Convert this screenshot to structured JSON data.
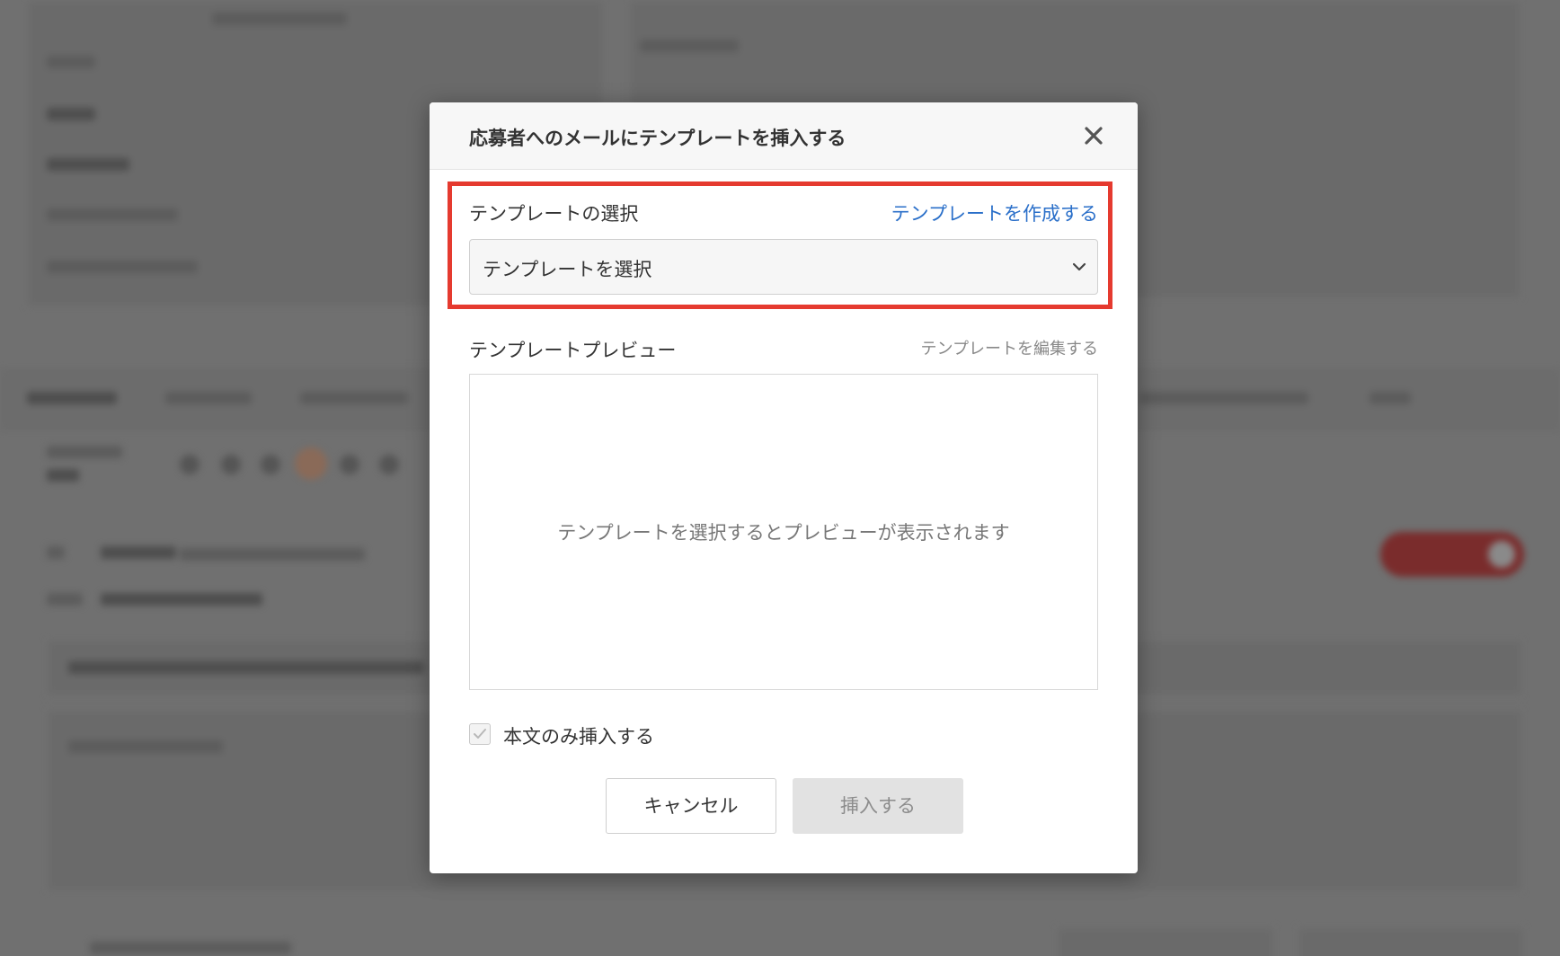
{
  "modal": {
    "title": "応募者へのメールにテンプレートを挿入する",
    "close_icon": "close-icon",
    "template_select_section": {
      "label": "テンプレートの選択",
      "create_link": "テンプレートを作成する",
      "select_value": "テンプレートを選択",
      "select_icon": "chevron-down-icon"
    },
    "preview_section": {
      "label": "テンプレートプレビュー",
      "edit_link": "テンプレートを編集する",
      "placeholder": "テンプレートを選択するとプレビューが表示されます"
    },
    "body_only": {
      "label": "本文のみ挿入する",
      "checked": true
    },
    "buttons": {
      "cancel": "キャンセル",
      "insert": "挿入する"
    }
  },
  "colors": {
    "overlay": "#707070",
    "highlight_border": "#e53a2f",
    "link": "#2a6fc9",
    "disabled_button": "#e2e2e2"
  }
}
